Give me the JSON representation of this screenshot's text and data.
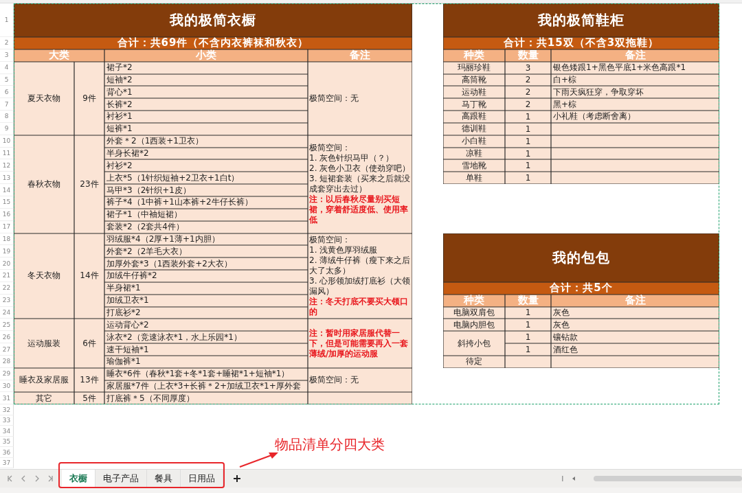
{
  "row_numbers": [
    "1",
    "2",
    "3",
    "4",
    "5",
    "6",
    "7",
    "8",
    "9",
    "10",
    "11",
    "12",
    "13",
    "14",
    "15",
    "16",
    "17",
    "18",
    "19",
    "20",
    "21",
    "22",
    "23",
    "24",
    "25",
    "26",
    "27",
    "28",
    "29",
    "30",
    "31",
    "32",
    "33",
    "34",
    "35",
    "36",
    "37"
  ],
  "wardrobe": {
    "title": "我的极简衣橱",
    "subtitle": "合计：共69件（不含内衣裤袜和秋衣）",
    "columns": [
      "大类",
      "小类",
      "备注"
    ],
    "groups": [
      {
        "category": "夏天衣物",
        "count": "9件",
        "items": [
          "裙子*2",
          "短袖*2",
          "背心*1",
          "长裤*2",
          "衬衫*1",
          "短裤*1"
        ],
        "notes": [
          {
            "kind": "plain",
            "text": "极简空间：无"
          }
        ]
      },
      {
        "category": "春秋衣物",
        "count": "23件",
        "items": [
          "外套＊2（1西装+1卫衣）",
          "半身长裙*2",
          "衬衫*2",
          "上衣*5（1针织短袖+2卫衣+1白t）",
          "马甲*3（2针织+1皮）",
          "裤子*4（1中裤+1山本裤+2牛仔长裤）",
          "裙子*1（中袖短裙）",
          "套装*2（2套共4件）"
        ],
        "notes": [
          {
            "kind": "plain",
            "text": "极简空间："
          },
          {
            "kind": "plain",
            "text": "1. 灰色针织马甲（？）"
          },
          {
            "kind": "plain",
            "text": "2. 灰色小卫衣（使劲穿吧）"
          },
          {
            "kind": "plain",
            "text": "3. 短裙套装（买来之后就没成套穿出去过）"
          },
          {
            "kind": "alert",
            "text": "注：以后春秋尽量别买短裙，穿着舒适度低、使用率低"
          }
        ]
      },
      {
        "category": "冬天衣物",
        "count": "14件",
        "items": [
          "羽绒服*4（2厚+1薄+1内胆）",
          "外套*2（2羊毛大衣）",
          "加厚外套*3（1西装外套+2大衣）",
          "加绒牛仔裤*2",
          "半身裙*1",
          "加绒卫衣*1",
          "打底衫*2"
        ],
        "notes": [
          {
            "kind": "plain",
            "text": "极简空间："
          },
          {
            "kind": "plain",
            "text": "1. 浅黄色厚羽绒服"
          },
          {
            "kind": "plain",
            "text": "2. 薄绒牛仔裤（瘦下来之后大了太多）"
          },
          {
            "kind": "plain",
            "text": "3. 心形领加绒打底衫（大领漏风）"
          },
          {
            "kind": "alert",
            "text": "注：冬天打底不要买大领口的"
          }
        ]
      },
      {
        "category": "运动服装",
        "count": "6件",
        "items": [
          "运动背心*2",
          "泳衣*2（竞速泳衣*1，水上乐园*1）",
          "速干短袖*1",
          "瑜伽裤*1"
        ],
        "notes": [
          {
            "kind": "alert",
            "text": "注：暂时用家居服代替一下，但是可能需要再入一套薄绒/加厚的运动服"
          }
        ]
      },
      {
        "category": "睡衣及家居服",
        "count": "13件",
        "items": [
          "睡衣*6件（春秋*1套+冬*1套+睡裙*1+短袖*1）",
          "家居服*7件（上衣*3+长裤＊2+加绒卫衣*1+厚外套"
        ],
        "notes": [
          {
            "kind": "plain",
            "text": "极简空间：无"
          }
        ]
      },
      {
        "category": "其它",
        "count": "5件",
        "items": [
          "打底裤＊5（不同厚度）"
        ]
      }
    ]
  },
  "shoes": {
    "title": "我的极简鞋柜",
    "subtitle": "合计：共15双（不含3双拖鞋）",
    "columns": [
      "种类",
      "数量",
      "备注"
    ],
    "rows": [
      {
        "type": "玛丽珍鞋",
        "count": "3",
        "note": "银色矮跟1+黑色平底1+米色高跟*1"
      },
      {
        "type": "高筒靴",
        "count": "2",
        "note": "白+棕"
      },
      {
        "type": "运动鞋",
        "count": "2",
        "note": "下雨天疯狂穿，争取穿坏"
      },
      {
        "type": "马丁靴",
        "count": "2",
        "note": "黑+棕"
      },
      {
        "type": "高跟鞋",
        "count": "1",
        "note": "小礼鞋（考虑断舍离）"
      },
      {
        "type": "德训鞋",
        "count": "1"
      },
      {
        "type": "小白鞋",
        "count": "1"
      },
      {
        "type": "凉鞋",
        "count": "1"
      },
      {
        "type": "雪地靴",
        "count": "1"
      },
      {
        "type": "单鞋",
        "count": "1"
      }
    ]
  },
  "bags": {
    "title": "我的包包",
    "subtitle": "合计：共5个",
    "columns": [
      "种类",
      "数量",
      "备注"
    ],
    "groups": [
      {
        "type": "电脑双肩包",
        "entries": [
          {
            "count": "1",
            "note": "灰色"
          }
        ]
      },
      {
        "type": "电脑内胆包",
        "entries": [
          {
            "count": "1",
            "note": "灰色"
          }
        ]
      },
      {
        "type": "斜挎小包",
        "entries": [
          {
            "count": "1",
            "note": "镶钻款"
          },
          {
            "count": "1",
            "note": "酒红色"
          }
        ]
      },
      {
        "type": "待定"
      }
    ]
  },
  "sheet_tabs": [
    {
      "label": "衣橱",
      "selected": true
    },
    {
      "label": "电子产品",
      "selected": false
    },
    {
      "label": "餐具",
      "selected": false
    },
    {
      "label": "日用品",
      "selected": false
    }
  ],
  "annotation": {
    "text": "物品清单分四大类"
  }
}
